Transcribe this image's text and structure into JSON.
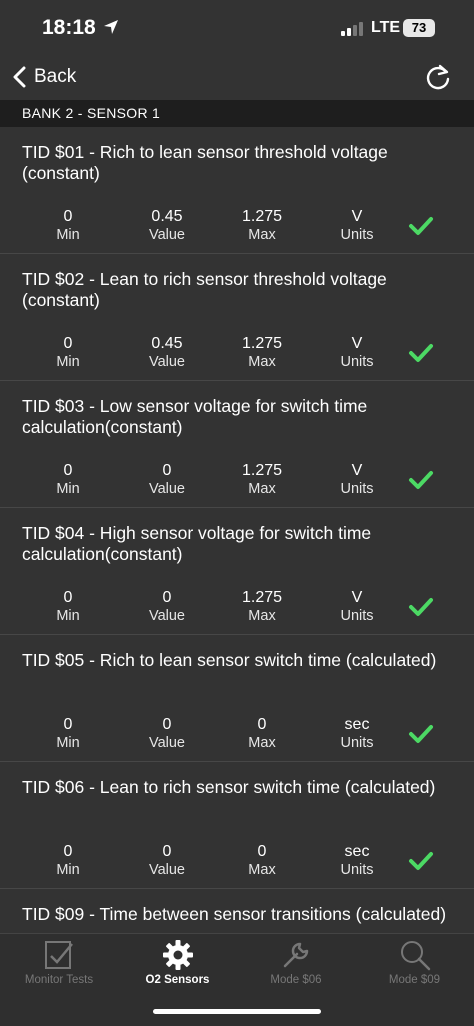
{
  "status_bar": {
    "time": "18:18",
    "network": "LTE",
    "battery": "73"
  },
  "nav": {
    "back_label": "Back"
  },
  "section": {
    "title": "BANK 2 - SENSOR 1"
  },
  "column_labels": {
    "min": "Min",
    "value": "Value",
    "max": "Max",
    "units": "Units"
  },
  "tests": [
    {
      "title": "TID $01 - Rich to lean sensor threshold voltage (constant)",
      "min": "0",
      "value": "0.45",
      "max": "1.275",
      "units": "V",
      "passed": true
    },
    {
      "title": "TID $02 - Lean to rich sensor threshold voltage (constant)",
      "min": "0",
      "value": "0.45",
      "max": "1.275",
      "units": "V",
      "passed": true
    },
    {
      "title": "TID $03 - Low sensor voltage for switch time calculation(constant)",
      "min": "0",
      "value": "0",
      "max": "1.275",
      "units": "V",
      "passed": true
    },
    {
      "title": "TID $04 - High sensor voltage for switch time calculation(constant)",
      "min": "0",
      "value": "0",
      "max": "1.275",
      "units": "V",
      "passed": true
    },
    {
      "title": "TID $05 - Rich to lean sensor switch time (calculated)",
      "min": "0",
      "value": "0",
      "max": "0",
      "units": "sec",
      "passed": true
    },
    {
      "title": "TID $06 - Lean to rich sensor switch time (calculated)",
      "min": "0",
      "value": "0",
      "max": "0",
      "units": "sec",
      "passed": true
    },
    {
      "title": "TID $09 - Time between sensor transitions (calculated)",
      "min": "",
      "value": "",
      "max": "",
      "units": "",
      "passed": false
    }
  ],
  "tabs": [
    {
      "label": "Monitor Tests",
      "icon": "clipboard-check-icon",
      "active": false
    },
    {
      "label": "O2 Sensors",
      "icon": "gear-icon",
      "active": true
    },
    {
      "label": "Mode $06",
      "icon": "wrench-icon",
      "active": false
    },
    {
      "label": "Mode $09",
      "icon": "magnifier-icon",
      "active": false
    }
  ],
  "colors": {
    "background": "#333333",
    "header": "#1e1e1e",
    "check": "#4cd964",
    "inactive_tab": "#777777"
  }
}
